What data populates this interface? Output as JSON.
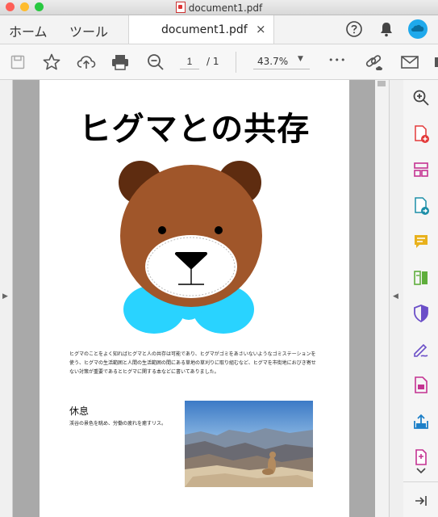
{
  "window": {
    "title": "document1.pdf",
    "traffic_lights": {
      "close": "#fe5f57",
      "minimize": "#febc2e",
      "zoom": "#28c840"
    }
  },
  "tabs": {
    "home": "ホーム",
    "tools": "ツール",
    "document": "document1.pdf",
    "close_icon": "×"
  },
  "toolbar": {
    "page_current": "1",
    "page_total": "/ 1",
    "zoom": "43.7%",
    "more": "•••"
  },
  "colors": {
    "accent": "#1fa9ec",
    "bear_fur": "#a0562a",
    "bear_ears": "#5e2c10",
    "bow_tie": "#29d3ff",
    "pdf_red": "#e33a3a",
    "tool_magenta": "#c43392",
    "tool_teal": "#1d8fa8",
    "tool_yellow": "#e8b11c",
    "tool_green": "#5fae3c",
    "tool_purple": "#6b4fc8",
    "tool_blue": "#1e80c8"
  },
  "document": {
    "heading": "ヒグマとの共存",
    "body": "ヒグマのことをよく知ればヒグマと人の共存は可能であり、ヒグマがゴミをあさいないようなゴミステーションを使う、ヒグマの生活範囲と人間の生活範囲の間にある草地の草刈りに取り組むなど、ヒグマを市街地におびき寄せない対策が重要であるとヒグマに関する本などに書いてありました。",
    "section_title": "休息",
    "section_text": "渓谷の景色を眺め、労働の疲れを癒すリス。"
  },
  "right_tools": [
    "search-zoom-icon",
    "create-pdf-icon",
    "organize-pages-icon",
    "export-pdf-icon",
    "comment-icon",
    "compare-icon",
    "protect-icon",
    "fill-sign-icon",
    "edit-pdf-icon",
    "share-icon",
    "more-tools-icon",
    "scroll-down-icon",
    "collapse-panel-icon"
  ]
}
